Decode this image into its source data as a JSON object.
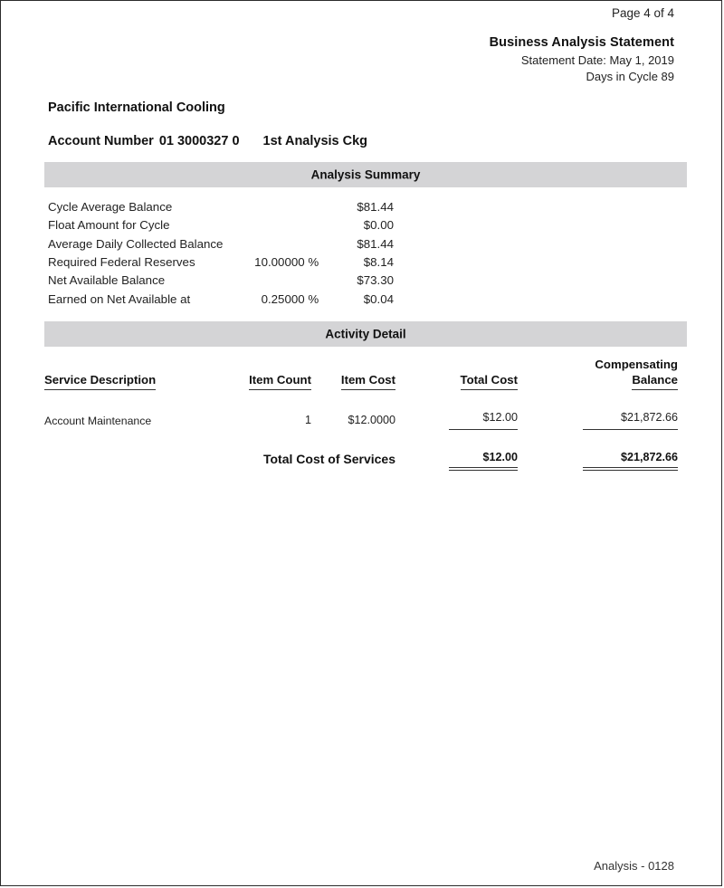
{
  "page": {
    "page_indicator": "Page 4 of 4",
    "footer_text": "Analysis - 0128",
    "band_color": "#d4d4d6"
  },
  "header": {
    "title": "Business Analysis Statement",
    "statement_date": "Statement Date: May 1, 2019",
    "days_in_cycle": "Days in Cycle 89"
  },
  "account": {
    "company_name": "Pacific International Cooling",
    "account_label": "Account Number",
    "account_number": "01 3000327 0",
    "account_type": "1st Analysis Ckg"
  },
  "summary": {
    "band_title": "Analysis Summary",
    "rows": [
      {
        "label": "Cycle Average Balance",
        "rate": "",
        "amount": "$81.44"
      },
      {
        "label": "Float Amount for Cycle",
        "rate": "",
        "amount": "$0.00"
      },
      {
        "label": "Average Daily Collected Balance",
        "rate": "",
        "amount": "$81.44"
      },
      {
        "label": "Required Federal Reserves",
        "rate": "10.00000 %",
        "amount": "$8.14"
      },
      {
        "label": "Net Available Balance",
        "rate": "",
        "amount": "$73.30"
      },
      {
        "label": "Earned on Net Available at",
        "rate": "0.25000 %",
        "amount": "$0.04"
      }
    ]
  },
  "activity": {
    "band_title": "Activity Detail",
    "columns": {
      "service": "Service Description",
      "item_count": "Item Count",
      "item_cost": "Item Cost",
      "total_cost": "Total Cost",
      "compensating_balance_line1": "Compensating",
      "compensating_balance_line2": "Balance"
    },
    "rows": [
      {
        "service": "Account Maintenance",
        "item_count": "1",
        "item_cost": "$12.0000",
        "total_cost": "$12.00",
        "compensating_balance": "$21,872.66"
      }
    ],
    "totals": {
      "label": "Total Cost of Services",
      "total_cost": "$12.00",
      "compensating_balance": "$21,872.66"
    }
  }
}
